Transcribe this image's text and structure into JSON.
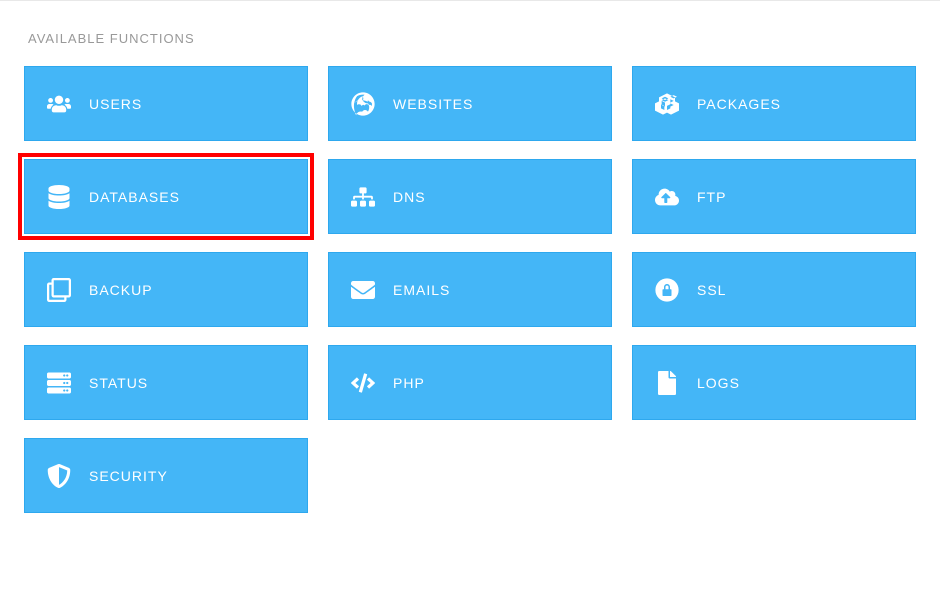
{
  "section_title": "AVAILABLE FUNCTIONS",
  "tiles": [
    {
      "id": "users",
      "label": "USERS",
      "icon": "users-icon"
    },
    {
      "id": "websites",
      "label": "WEBSITES",
      "icon": "globe-icon"
    },
    {
      "id": "packages",
      "label": "PACKAGES",
      "icon": "cubes-icon"
    },
    {
      "id": "databases",
      "label": "DATABASES",
      "icon": "database-icon",
      "highlighted": true
    },
    {
      "id": "dns",
      "label": "DNS",
      "icon": "sitemap-icon"
    },
    {
      "id": "ftp",
      "label": "FTP",
      "icon": "cloud-upload-icon"
    },
    {
      "id": "backup",
      "label": "BACKUP",
      "icon": "copy-icon"
    },
    {
      "id": "emails",
      "label": "EMAILS",
      "icon": "envelope-icon"
    },
    {
      "id": "ssl",
      "label": "SSL",
      "icon": "lock-circle-icon"
    },
    {
      "id": "status",
      "label": "STATUS",
      "icon": "server-icon"
    },
    {
      "id": "php",
      "label": "PHP",
      "icon": "code-icon"
    },
    {
      "id": "logs",
      "label": "LOGS",
      "icon": "file-icon"
    },
    {
      "id": "security",
      "label": "SECURITY",
      "icon": "shield-icon"
    }
  ]
}
